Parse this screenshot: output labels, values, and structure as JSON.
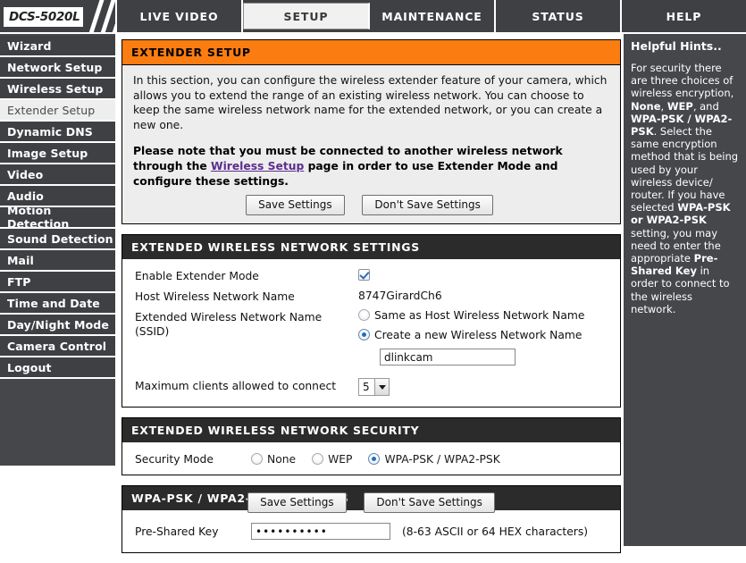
{
  "brand": {
    "model": "DCS-5020L"
  },
  "topnav": {
    "tabs": [
      {
        "label": "LIVE VIDEO",
        "active": false
      },
      {
        "label": "SETUP",
        "active": true
      },
      {
        "label": "MAINTENANCE",
        "active": false
      },
      {
        "label": "STATUS",
        "active": false
      },
      {
        "label": "HELP",
        "active": false
      }
    ]
  },
  "sidebar": {
    "items": [
      {
        "label": "Wizard",
        "active": false
      },
      {
        "label": "Network Setup",
        "active": false
      },
      {
        "label": "Wireless Setup",
        "active": false
      },
      {
        "label": "Extender Setup",
        "active": true
      },
      {
        "label": "Dynamic DNS",
        "active": false
      },
      {
        "label": "Image Setup",
        "active": false
      },
      {
        "label": "Video",
        "active": false
      },
      {
        "label": "Audio",
        "active": false
      },
      {
        "label": "Motion Detection",
        "active": false
      },
      {
        "label": "Sound Detection",
        "active": false
      },
      {
        "label": "Mail",
        "active": false
      },
      {
        "label": "FTP",
        "active": false
      },
      {
        "label": "Time and Date",
        "active": false
      },
      {
        "label": "Day/Night Mode",
        "active": false
      },
      {
        "label": "Camera Control",
        "active": false
      },
      {
        "label": "Logout",
        "active": false
      }
    ]
  },
  "intro": {
    "title": "EXTENDER SETUP",
    "paragraph": "In this section, you can configure the wireless extender feature of your camera, which allows you to extend the range of an existing wireless network. You can choose to keep the same wireless network name for the extended network, or you can create a new one.",
    "note_prefix": "Please note that you must be connected to another wireless network through the ",
    "note_link": "Wireless Setup",
    "note_suffix": " page in order to use Extender Mode and configure these settings.",
    "save_label": "Save Settings",
    "dont_save_label": "Don't Save Settings"
  },
  "network_settings": {
    "title": "EXTENDED WIRELESS NETWORK SETTINGS",
    "enable_label": "Enable Extender Mode",
    "enable_checked": true,
    "host_label": "Host Wireless Network Name",
    "host_value": "8747GirardCh6",
    "ssid_label": "Extended Wireless Network Name (SSID)",
    "ssid_option_same": "Same as Host Wireless Network Name",
    "ssid_option_new": "Create a new Wireless Network Name",
    "ssid_selected": "new",
    "ssid_value": "dlinkcam",
    "max_clients_label": "Maximum clients allowed to connect",
    "max_clients_value": "5"
  },
  "security": {
    "title": "EXTENDED WIRELESS NETWORK SECURITY",
    "mode_label": "Security Mode",
    "options": [
      {
        "label": "None",
        "selected": false
      },
      {
        "label": "WEP",
        "selected": false
      },
      {
        "label": "WPA-PSK / WPA2-PSK",
        "selected": true
      }
    ]
  },
  "wpa": {
    "title": "WPA-PSK / WPA2-PSK SETTINGS",
    "psk_label": "Pre-Shared Key",
    "psk_value": "••••••••••",
    "psk_hint": "(8-63 ASCII or 64 HEX characters)"
  },
  "footer": {
    "save_label": "Save Settings",
    "dont_save_label": "Don't Save Settings"
  },
  "hints": {
    "title": "Helpful Hints..",
    "seg1": "For security there are three choices of wireless encryption, ",
    "b1": "None",
    "seg2": ", ",
    "b2": "WEP",
    "seg3": ", and ",
    "b3": "WPA-PSK / WPA2-PSK",
    "seg4": ". Select the same encryption method that is being used by your wireless device/ router. If you have selected ",
    "b4": "WPA-PSK or WPA2-PSK",
    "seg5": " setting, you may need to enter the appropriate ",
    "b5": "Pre-Shared Key",
    "seg6": " in order to connect to the wireless network."
  },
  "colors": {
    "accent_orange": "#fb7d11",
    "nav_dark": "#3f4044",
    "panel_dark": "#2b2b2b",
    "link_purple": "#5b2d8e",
    "radio_blue": "#1f6fc4"
  }
}
